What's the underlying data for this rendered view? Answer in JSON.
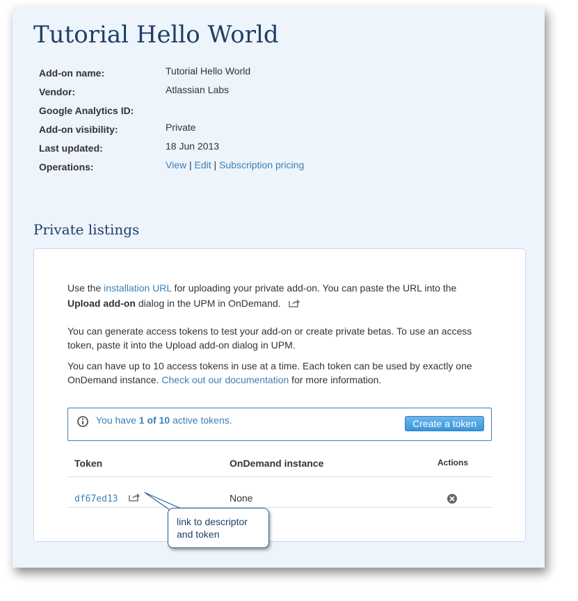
{
  "title": "Tutorial Hello World",
  "details": [
    {
      "label": "Add-on name:",
      "value": "Tutorial Hello World"
    },
    {
      "label": "Vendor:",
      "value": "Atlassian Labs"
    },
    {
      "label": "Google Analytics ID:",
      "value": ""
    },
    {
      "label": "Add-on visibility:",
      "value": "Private"
    },
    {
      "label": "Last updated:",
      "value": "18 Jun 2013"
    },
    {
      "label": "Operations:",
      "value": ""
    }
  ],
  "operations": {
    "view": "View",
    "edit": "Edit",
    "pricing": "Subscription pricing",
    "separator": "|"
  },
  "private_listings": {
    "title": "Private listings",
    "para1": {
      "pre": "Use the ",
      "link": "installation URL",
      "post": " for uploading your private add-on. You can paste the URL into the",
      "bold": "Upload add-on",
      "post2": " dialog in the UPM in OnDemand."
    },
    "para2": "You can generate access tokens to test your add-on or create private betas. To use an access token, paste it into the Upload add-on dialog in UPM.",
    "para3": {
      "pre": "You can have up to 10 access tokens in use at a time. Each token can be used by exactly one OnDemand instance. ",
      "link": "Check out our documentation",
      "post": " for more information."
    },
    "notice": {
      "pre": "You have ",
      "count": "1 of 10",
      "post": " active tokens."
    },
    "create_button": "Create a token",
    "table": {
      "headers": [
        "Token",
        "OnDemand instance",
        "Actions"
      ],
      "rows": [
        {
          "token": "df67ed13",
          "instance": "None"
        }
      ]
    }
  },
  "callout": {
    "line1": "link to descriptor",
    "line2": "and token"
  },
  "colors": {
    "link": "#3b7fb6",
    "heading": "#1d3f67",
    "background": "#eef4fb"
  },
  "icons": [
    "share-icon",
    "info-icon",
    "remove-icon"
  ]
}
